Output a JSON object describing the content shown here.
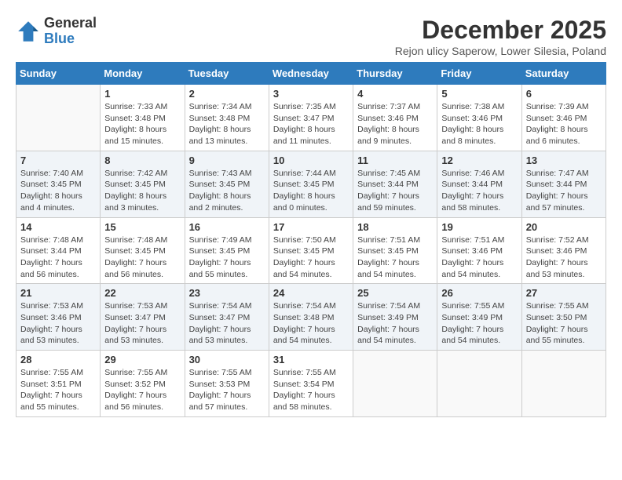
{
  "logo": {
    "general": "General",
    "blue": "Blue"
  },
  "title": "December 2025",
  "subtitle": "Rejon ulicy Saperow, Lower Silesia, Poland",
  "weekdays": [
    "Sunday",
    "Monday",
    "Tuesday",
    "Wednesday",
    "Thursday",
    "Friday",
    "Saturday"
  ],
  "weeks": [
    [
      {
        "day": "",
        "info": ""
      },
      {
        "day": "1",
        "info": "Sunrise: 7:33 AM\nSunset: 3:48 PM\nDaylight: 8 hours\nand 15 minutes."
      },
      {
        "day": "2",
        "info": "Sunrise: 7:34 AM\nSunset: 3:48 PM\nDaylight: 8 hours\nand 13 minutes."
      },
      {
        "day": "3",
        "info": "Sunrise: 7:35 AM\nSunset: 3:47 PM\nDaylight: 8 hours\nand 11 minutes."
      },
      {
        "day": "4",
        "info": "Sunrise: 7:37 AM\nSunset: 3:46 PM\nDaylight: 8 hours\nand 9 minutes."
      },
      {
        "day": "5",
        "info": "Sunrise: 7:38 AM\nSunset: 3:46 PM\nDaylight: 8 hours\nand 8 minutes."
      },
      {
        "day": "6",
        "info": "Sunrise: 7:39 AM\nSunset: 3:46 PM\nDaylight: 8 hours\nand 6 minutes."
      }
    ],
    [
      {
        "day": "7",
        "info": "Sunrise: 7:40 AM\nSunset: 3:45 PM\nDaylight: 8 hours\nand 4 minutes."
      },
      {
        "day": "8",
        "info": "Sunrise: 7:42 AM\nSunset: 3:45 PM\nDaylight: 8 hours\nand 3 minutes."
      },
      {
        "day": "9",
        "info": "Sunrise: 7:43 AM\nSunset: 3:45 PM\nDaylight: 8 hours\nand 2 minutes."
      },
      {
        "day": "10",
        "info": "Sunrise: 7:44 AM\nSunset: 3:45 PM\nDaylight: 8 hours\nand 0 minutes."
      },
      {
        "day": "11",
        "info": "Sunrise: 7:45 AM\nSunset: 3:44 PM\nDaylight: 7 hours\nand 59 minutes."
      },
      {
        "day": "12",
        "info": "Sunrise: 7:46 AM\nSunset: 3:44 PM\nDaylight: 7 hours\nand 58 minutes."
      },
      {
        "day": "13",
        "info": "Sunrise: 7:47 AM\nSunset: 3:44 PM\nDaylight: 7 hours\nand 57 minutes."
      }
    ],
    [
      {
        "day": "14",
        "info": "Sunrise: 7:48 AM\nSunset: 3:44 PM\nDaylight: 7 hours\nand 56 minutes."
      },
      {
        "day": "15",
        "info": "Sunrise: 7:48 AM\nSunset: 3:45 PM\nDaylight: 7 hours\nand 56 minutes."
      },
      {
        "day": "16",
        "info": "Sunrise: 7:49 AM\nSunset: 3:45 PM\nDaylight: 7 hours\nand 55 minutes."
      },
      {
        "day": "17",
        "info": "Sunrise: 7:50 AM\nSunset: 3:45 PM\nDaylight: 7 hours\nand 54 minutes."
      },
      {
        "day": "18",
        "info": "Sunrise: 7:51 AM\nSunset: 3:45 PM\nDaylight: 7 hours\nand 54 minutes."
      },
      {
        "day": "19",
        "info": "Sunrise: 7:51 AM\nSunset: 3:46 PM\nDaylight: 7 hours\nand 54 minutes."
      },
      {
        "day": "20",
        "info": "Sunrise: 7:52 AM\nSunset: 3:46 PM\nDaylight: 7 hours\nand 53 minutes."
      }
    ],
    [
      {
        "day": "21",
        "info": "Sunrise: 7:53 AM\nSunset: 3:46 PM\nDaylight: 7 hours\nand 53 minutes."
      },
      {
        "day": "22",
        "info": "Sunrise: 7:53 AM\nSunset: 3:47 PM\nDaylight: 7 hours\nand 53 minutes."
      },
      {
        "day": "23",
        "info": "Sunrise: 7:54 AM\nSunset: 3:47 PM\nDaylight: 7 hours\nand 53 minutes."
      },
      {
        "day": "24",
        "info": "Sunrise: 7:54 AM\nSunset: 3:48 PM\nDaylight: 7 hours\nand 54 minutes."
      },
      {
        "day": "25",
        "info": "Sunrise: 7:54 AM\nSunset: 3:49 PM\nDaylight: 7 hours\nand 54 minutes."
      },
      {
        "day": "26",
        "info": "Sunrise: 7:55 AM\nSunset: 3:49 PM\nDaylight: 7 hours\nand 54 minutes."
      },
      {
        "day": "27",
        "info": "Sunrise: 7:55 AM\nSunset: 3:50 PM\nDaylight: 7 hours\nand 55 minutes."
      }
    ],
    [
      {
        "day": "28",
        "info": "Sunrise: 7:55 AM\nSunset: 3:51 PM\nDaylight: 7 hours\nand 55 minutes."
      },
      {
        "day": "29",
        "info": "Sunrise: 7:55 AM\nSunset: 3:52 PM\nDaylight: 7 hours\nand 56 minutes."
      },
      {
        "day": "30",
        "info": "Sunrise: 7:55 AM\nSunset: 3:53 PM\nDaylight: 7 hours\nand 57 minutes."
      },
      {
        "day": "31",
        "info": "Sunrise: 7:55 AM\nSunset: 3:54 PM\nDaylight: 7 hours\nand 58 minutes."
      },
      {
        "day": "",
        "info": ""
      },
      {
        "day": "",
        "info": ""
      },
      {
        "day": "",
        "info": ""
      }
    ]
  ]
}
